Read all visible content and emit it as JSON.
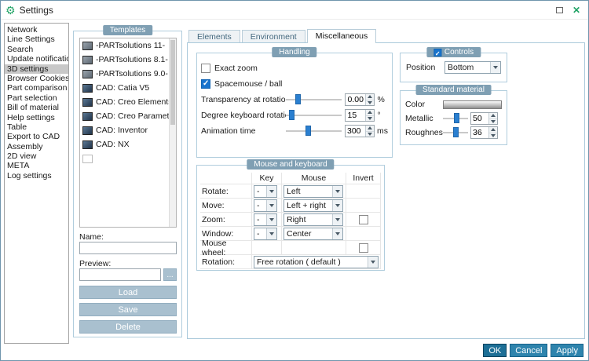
{
  "window": {
    "title": "Settings"
  },
  "icons": {
    "gear": "⚙",
    "close": "✕",
    "browse": "..."
  },
  "sidebar": {
    "items": [
      "Network",
      "Line Settings",
      "Search",
      "Update notification",
      "3D settings",
      "Browser Cookies",
      "Part comparison",
      "Part selection",
      "Bill of material",
      "Help settings",
      "Table",
      "Export to CAD",
      "Assembly",
      "2D view",
      "META",
      "Log settings"
    ],
    "selected": "3D settings"
  },
  "templates": {
    "header": "Templates",
    "items": [
      "-PARTsolutions 11-",
      "-PARTsolutions 8.1-",
      "-PARTsolutions 9.0-",
      "CAD: Catia V5",
      "CAD: Creo Elements/Direc",
      "CAD: Creo Parametric",
      "CAD: Inventor",
      "CAD: NX",
      ""
    ],
    "name_label": "Name:",
    "name_value": "",
    "preview_label": "Preview:",
    "preview_value": "",
    "browse_label": "...",
    "load_label": "Load",
    "save_label": "Save",
    "delete_label": "Delete"
  },
  "tabs": {
    "elements": "Elements",
    "environment": "Environment",
    "miscellaneous": "Miscellaneous",
    "active": "Miscellaneous"
  },
  "handling": {
    "header": "Handling",
    "exact_zoom_label": "Exact zoom",
    "exact_zoom_checked": false,
    "spacemouse_label": "Spacemouse / ball",
    "spacemouse_checked": true,
    "transparency": {
      "label": "Transparency at rotation",
      "value": "0.00",
      "unit": "%"
    },
    "degree": {
      "label": "Degree keyboard rotation",
      "value": "15",
      "unit": "°"
    },
    "animation": {
      "label": "Animation time",
      "value": "300",
      "unit": "ms"
    }
  },
  "controls": {
    "header": "Controls",
    "header_checked": true,
    "position_label": "Position",
    "position_value": "Bottom"
  },
  "standard_material": {
    "header": "Standard material",
    "color_label": "Color",
    "metallic": {
      "label": "Metallic",
      "value": "50"
    },
    "roughness": {
      "label": "Roughness",
      "value": "36"
    }
  },
  "mouse_keyboard": {
    "header": "Mouse and keyboard",
    "columns": {
      "key": "Key",
      "mouse": "Mouse",
      "invert": "Invert"
    },
    "rows": {
      "rotate": {
        "label": "Rotate:",
        "key": "-",
        "mouse": "Left"
      },
      "move": {
        "label": "Move:",
        "key": "-",
        "mouse": "Left + right"
      },
      "zoom": {
        "label": "Zoom:",
        "key": "-",
        "mouse": "Right",
        "invert_checked": false
      },
      "window": {
        "label": "Window:",
        "key": "-",
        "mouse": "Center"
      },
      "mouse_wheel": {
        "label": "Mouse wheel:",
        "invert_checked": false
      },
      "rotation": {
        "label": "Rotation:",
        "value": "Free rotation ( default )"
      }
    }
  },
  "footer": {
    "ok": "OK",
    "cancel": "Cancel",
    "apply": "Apply"
  }
}
